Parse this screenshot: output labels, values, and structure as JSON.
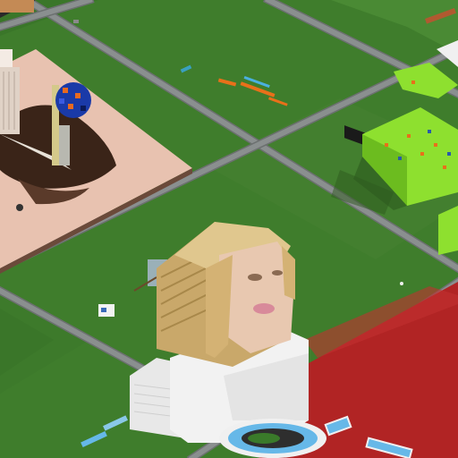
{
  "scene": {
    "kind": "isometric-voxel-world",
    "colors": {
      "grass": "#3f7d2c",
      "grass_dark": "#356b25",
      "road": "#8a8f8f",
      "road_edge": "#6c7070",
      "pink_plot": "#e8c2b0",
      "red_plot": "#b12424",
      "lime_build": "#8ee02f",
      "face_hair": "#d6b77a",
      "face_skin": "#e6c2a8",
      "white_body": "#f2f2f2",
      "water": "#66b8e8"
    },
    "builds": [
      {
        "name": "giant-portrait-bust",
        "icon": "portrait-icon"
      },
      {
        "name": "lime-green-structure",
        "icon": "block-icon"
      },
      {
        "name": "tower-on-pink-plot",
        "icon": "tower-icon"
      },
      {
        "name": "blue-voxel-sphere",
        "icon": "sphere-icon"
      },
      {
        "name": "red-plot",
        "icon": "plot-icon"
      },
      {
        "name": "ring-pool",
        "icon": "pool-icon"
      }
    ]
  }
}
